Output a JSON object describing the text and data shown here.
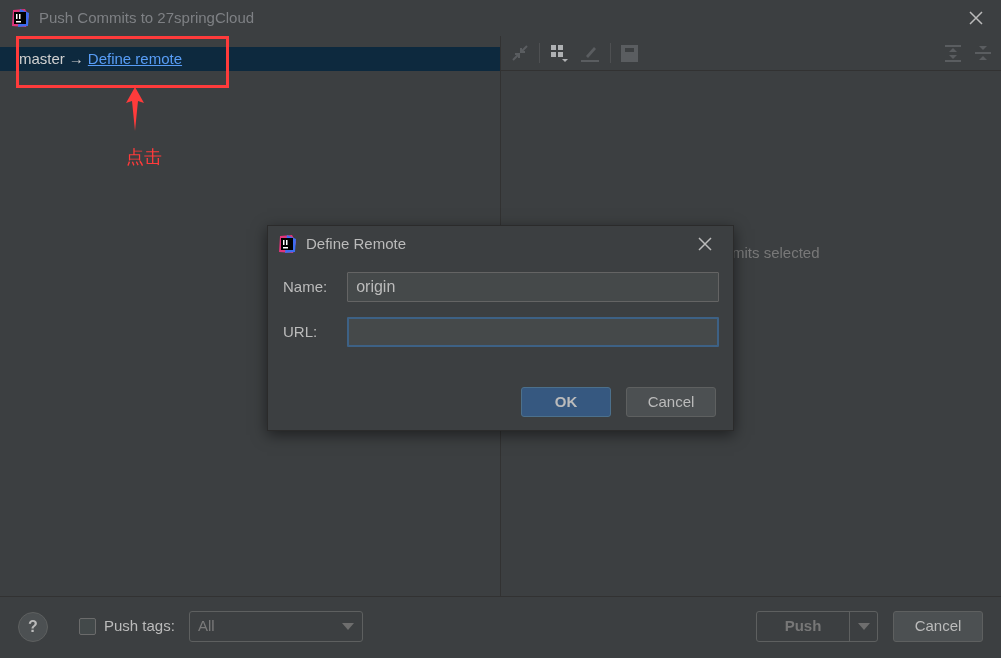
{
  "window": {
    "title": "Push Commits to 27springCloud"
  },
  "push_tree": {
    "branch": "master",
    "arrow": "→",
    "link": "Define remote",
    "selected": true
  },
  "annotation": {
    "label": "点击"
  },
  "details": {
    "empty_text": "mits selected"
  },
  "dialog": {
    "title": "Define Remote",
    "fields": [
      {
        "label": "Name:",
        "value": "origin",
        "focused": false
      },
      {
        "label": "URL:",
        "focused": true
      }
    ],
    "buttons": [
      {
        "label": "OK",
        "default": true
      },
      {
        "label": "Cancel",
        "default": false
      }
    ]
  },
  "footer": {
    "help": "?",
    "push_tags": {
      "label": "Push tags:",
      "checked": false
    },
    "tags_select": {
      "value": "All"
    },
    "buttons": [
      {
        "label": "Push",
        "kind": "split"
      },
      {
        "label": "Cancel",
        "kind": "plain"
      }
    ]
  }
}
